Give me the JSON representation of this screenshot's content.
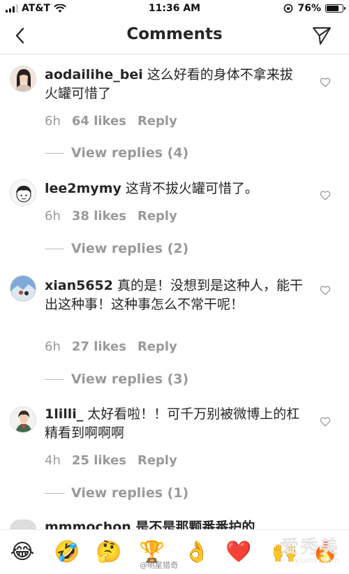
{
  "status_bar": {
    "carrier": "AT&T",
    "time": "11:36 AM",
    "battery": "76%",
    "battery_level": 0.76
  },
  "header": {
    "title": "Comments"
  },
  "comments": [
    {
      "username": "aodailihe_bei",
      "text": "这么好看的身体不拿来拔火罐可惜了",
      "time": "6h",
      "likes": "64 likes",
      "reply": "Reply",
      "view_replies": "View replies (4)"
    },
    {
      "username": "lee2mymy",
      "text": "这背不拔火罐可惜了。",
      "time": "6h",
      "likes": "38 likes",
      "reply": "Reply",
      "view_replies": "View replies (2)"
    },
    {
      "username": "xian5652",
      "text": "真的是！没想到是这种人，能干出这种事！这种事怎么不常干呢！",
      "time": "6h",
      "likes": "27 likes",
      "reply": "Reply",
      "view_replies": "View replies (3)"
    },
    {
      "username": "1lilli_",
      "text": "太好看啦！！可千万别被微博上的杠精看到啊啊啊",
      "time": "4h",
      "likes": "25 likes",
      "reply": "Reply",
      "view_replies": "View replies (1)"
    }
  ],
  "cut_comment": {
    "text": "mmmochon 是不是那颗番番护的"
  },
  "emoji_bar": {
    "emojis": [
      "😂",
      "🤣",
      "🤔",
      "🏆",
      "👌",
      "❤️",
      "🙌",
      "🔥"
    ]
  },
  "watermark": {
    "handle": "@明星猎奇",
    "logo": "爱秀美",
    "url": "ixiumei.com"
  },
  "colors": {
    "text": "#262626",
    "muted": "#999999",
    "divider": "#e3e3e3"
  }
}
